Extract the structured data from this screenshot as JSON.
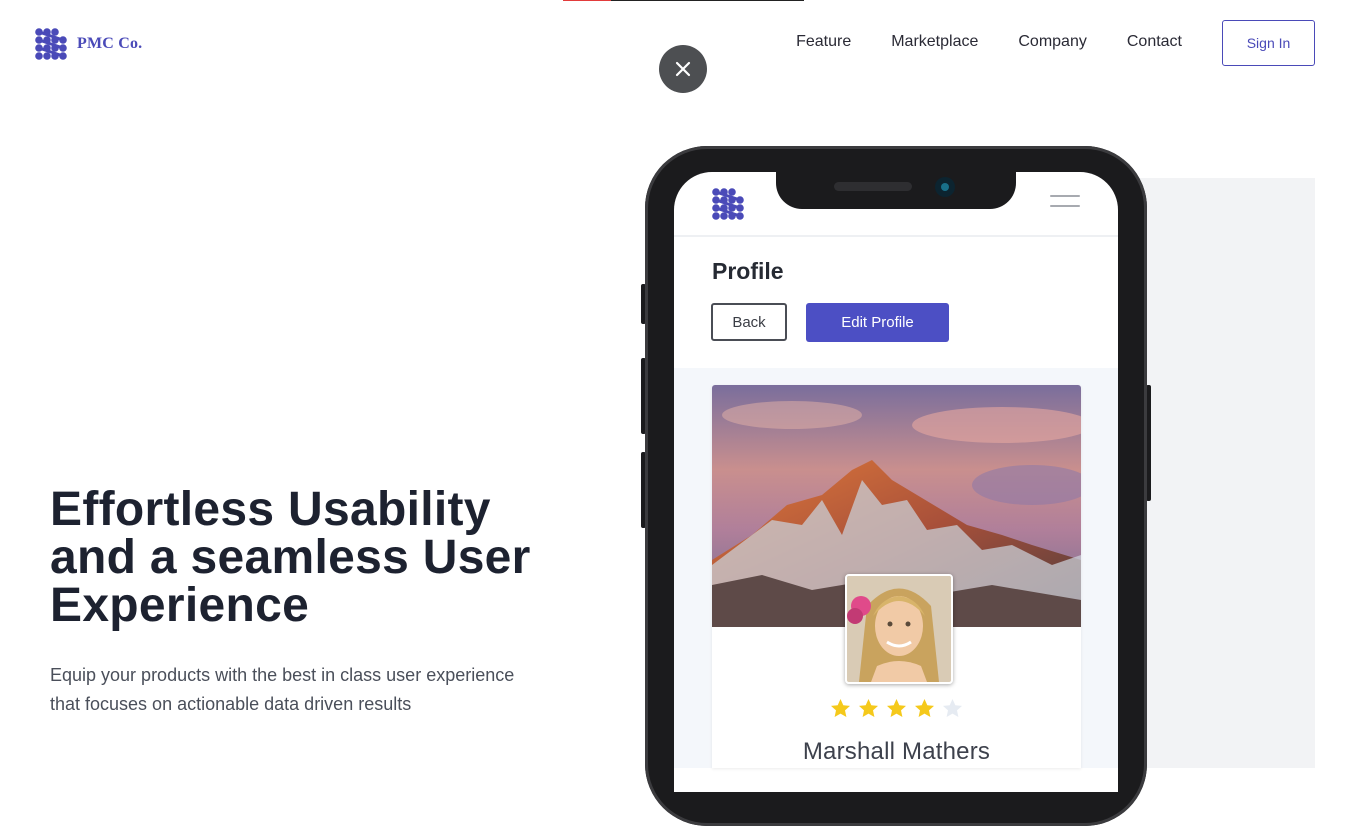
{
  "progress": {
    "value": 0.2,
    "color": "#e23b3b"
  },
  "brand": {
    "name": "PMC Co.",
    "color": "#4a4ab8",
    "icon": "pmc-logo-icon"
  },
  "nav": {
    "items": [
      {
        "label": "Feature"
      },
      {
        "label": "Marketplace"
      },
      {
        "label": "Company"
      },
      {
        "label": "Contact"
      }
    ],
    "signin_label": "Sign In"
  },
  "overlay": {
    "close_icon": "close-icon"
  },
  "hero": {
    "title": "Effortless Usability and a seamless User Experience",
    "subtitle": "Equip your products with the best in class user experience that focuses on actionable data driven results"
  },
  "phone_app": {
    "menu_icon": "hamburger-icon",
    "page_title": "Profile",
    "back_label": "Back",
    "edit_label": "Edit Profile",
    "accent": "#4c4fc4",
    "profile": {
      "name": "Marshall Mathers",
      "rating": 4,
      "rating_max": 5,
      "star_color": "#f5c91b",
      "star_empty_color": "#e6ebf2"
    }
  }
}
